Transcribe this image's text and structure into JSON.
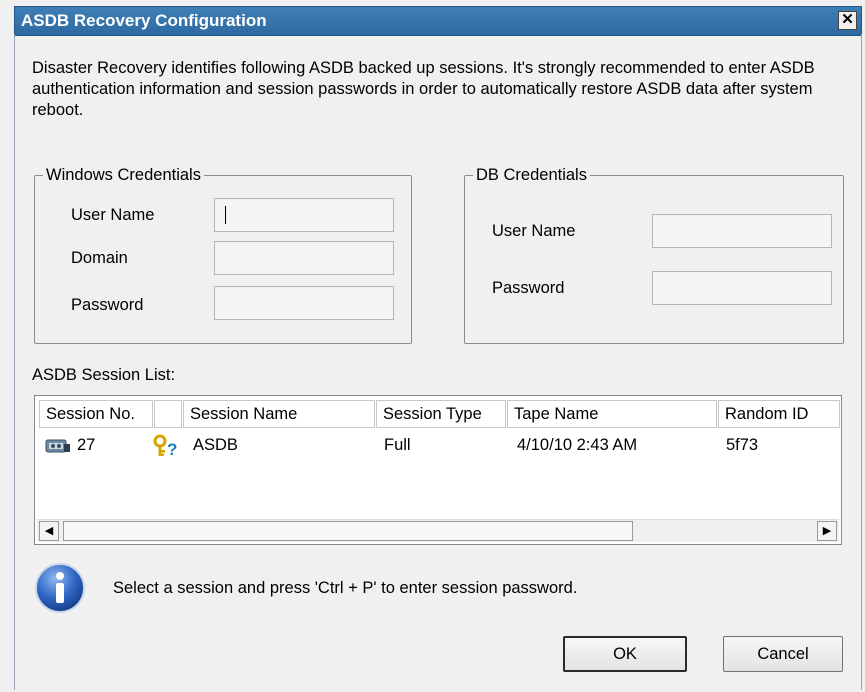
{
  "window": {
    "title": "ASDB Recovery Configuration",
    "close_glyph": "✕"
  },
  "intro_text": "Disaster Recovery identifies following ASDB backed up sessions. It's strongly recommended to enter ASDB authentication information and session passwords in order to automatically restore ASDB data after system reboot.",
  "windows_credentials": {
    "legend": "Windows Credentials",
    "user_name_label": "User Name",
    "user_name_value": "",
    "domain_label": "Domain",
    "domain_value": "",
    "password_label": "Password",
    "password_value": ""
  },
  "db_credentials": {
    "legend": "DB Credentials",
    "user_name_label": "User Name",
    "user_name_value": "",
    "password_label": "Password",
    "password_value": ""
  },
  "session_list": {
    "label": "ASDB Session List:",
    "columns": [
      "Session No.",
      "",
      "Session Name",
      "Session Type",
      "Tape Name",
      "Random ID"
    ],
    "rows": [
      {
        "icon": "tape-icon",
        "session_no": "27",
        "key_icon": "key-question-icon",
        "session_name": "ASDB",
        "session_type": "Full",
        "tape_name": "4/10/10 2:43 AM",
        "random_id": "5f73"
      }
    ],
    "scroll_left_glyph": "◀",
    "scroll_right_glyph": "▶"
  },
  "info": {
    "icon": "info-icon",
    "text": "Select a session and press 'Ctrl + P' to enter session password."
  },
  "buttons": {
    "ok": "OK",
    "cancel": "Cancel"
  }
}
